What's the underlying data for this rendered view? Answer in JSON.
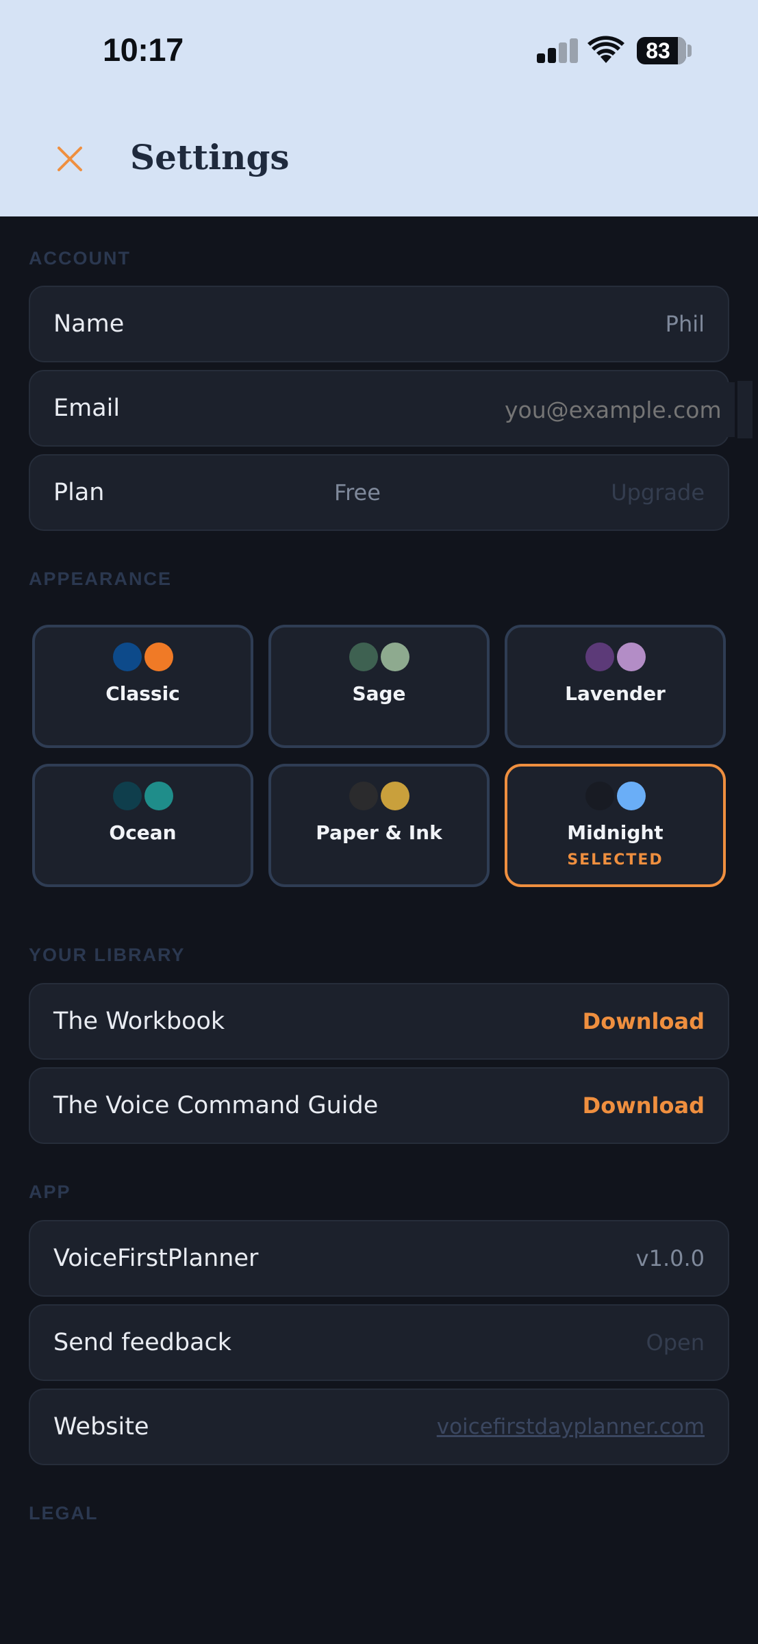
{
  "status_bar": {
    "time": "10:17",
    "battery": "83"
  },
  "header": {
    "title": "Settings",
    "close_icon": "close-icon",
    "close_color": "#ef8f3f"
  },
  "account": {
    "section_label": "ACCOUNT",
    "name": {
      "label": "Name",
      "value": "Phil"
    },
    "email": {
      "label": "Email",
      "placeholder": "you@example.com"
    },
    "plan": {
      "label": "Plan",
      "value": "Free",
      "action": "Upgrade"
    }
  },
  "appearance": {
    "section_label": "APPEARANCE",
    "selected_label": "SELECTED",
    "themes": [
      {
        "name": "Classic",
        "colors": [
          "#0d4a8a",
          "#f07a26"
        ],
        "selected": false
      },
      {
        "name": "Sage",
        "colors": [
          "#3e6151",
          "#8eaa8f"
        ],
        "selected": false
      },
      {
        "name": "Lavender",
        "colors": [
          "#5c3a78",
          "#b38dc6"
        ],
        "selected": false
      },
      {
        "name": "Ocean",
        "colors": [
          "#0f3e4c",
          "#1f8d8a"
        ],
        "selected": false
      },
      {
        "name": "Paper & Ink",
        "colors": [
          "#2b2b2d",
          "#c9a03c"
        ],
        "selected": false
      },
      {
        "name": "Midnight",
        "colors": [
          "#181b23",
          "#6aaef7"
        ],
        "selected": true
      }
    ]
  },
  "library": {
    "section_label": "YOUR LIBRARY",
    "items": [
      {
        "label": "The Workbook",
        "action": "Download"
      },
      {
        "label": "The Voice Command Guide",
        "action": "Download"
      }
    ]
  },
  "app": {
    "section_label": "APP",
    "version": {
      "label": "VoiceFirstPlanner",
      "value": "v1.0.0"
    },
    "feedback": {
      "label": "Send feedback",
      "action": "Open"
    },
    "website": {
      "label": "Website",
      "link": "voicefirstdayplanner.com"
    }
  },
  "legal": {
    "section_label": "LEGAL"
  },
  "colors": {
    "accent": "#ef8f3f",
    "background": "#11141c",
    "header_bg": "#d6e3f5",
    "card": "#1c212c"
  }
}
